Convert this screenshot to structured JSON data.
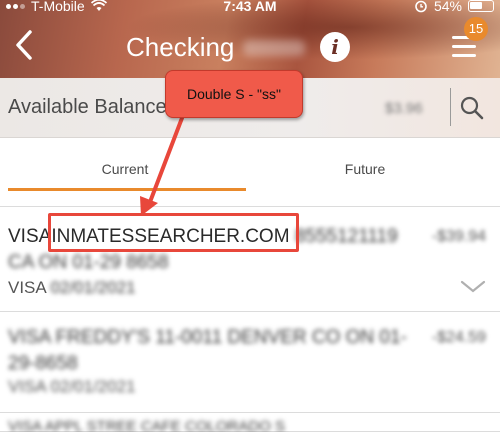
{
  "status_bar": {
    "carrier": "T-Mobile",
    "time": "7:43 AM",
    "battery": "54%"
  },
  "header": {
    "title": "Checking",
    "info_label": "i",
    "notification_count": "15"
  },
  "balance": {
    "label": "Available Balance:",
    "value": "$3.96"
  },
  "tabs": [
    {
      "label": "Current",
      "active": true
    },
    {
      "label": "Future",
      "active": false
    }
  ],
  "transactions": [
    {
      "prefix": "VISA",
      "merchant": "INMATESSEARCHER.COM",
      "phone": "8555121119",
      "line2": "CA ON 01-29 8658",
      "amount": "-$39.94",
      "type": "VISA",
      "date": "02/01/2021"
    },
    {
      "line1": "VISA FREDDY'S 11-0011 DENVER CO ON 01-",
      "line2": "29-8658",
      "amount": "-$24.59",
      "type": "VISA",
      "date": "02/01/2021"
    },
    {
      "line1": "VISA APPL STREE CAFE COLORADO S"
    }
  ],
  "annotation": {
    "callout_text": "Double S - \"ss\"",
    "color": "#e8473b"
  },
  "colors": {
    "accent": "#e98a2c",
    "annotation": "#f05a4a"
  }
}
